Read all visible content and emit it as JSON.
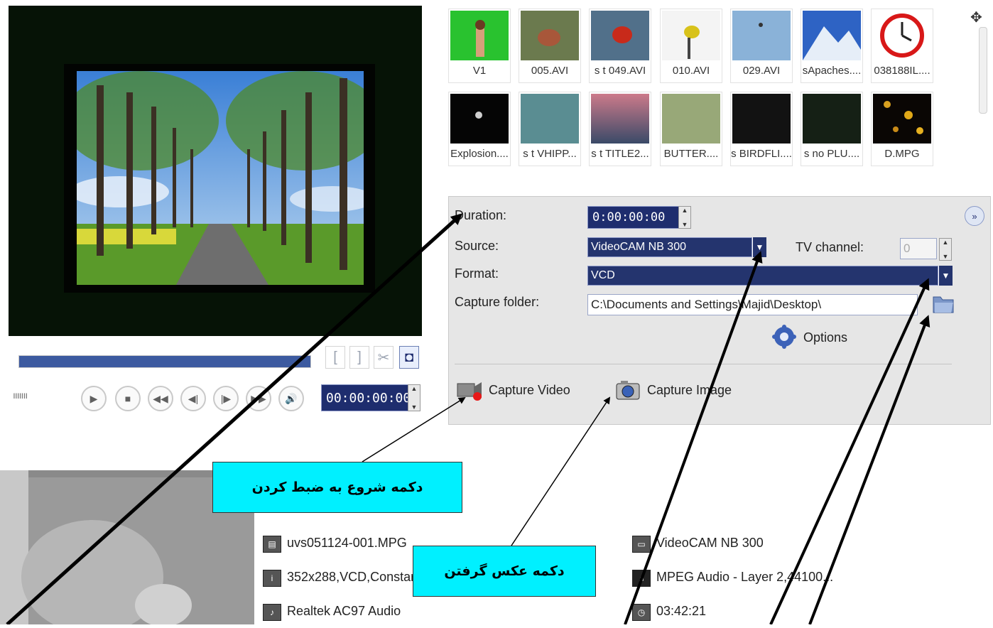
{
  "player": {
    "jog_marks": "ııııııı",
    "timecode": "00:00:00:00",
    "mark_in": "[",
    "mark_out": "]",
    "scissors": "✂",
    "snapshot": "◘"
  },
  "library": {
    "row1": [
      "V1",
      "005.AVI",
      "s t  049.AVI",
      "010.AVI",
      "029.AVI",
      "sApaches....",
      "038188IL...."
    ],
    "row2": [
      "Explosion....",
      "s t VHIPP...",
      "s t TITLE2...",
      "BUTTER....",
      "s BIRDFLI....",
      "s no  PLU....",
      "D.MPG"
    ]
  },
  "capture": {
    "duration_label": "Duration:",
    "duration_value": "0:00:00:00",
    "source_label": "Source:",
    "source_value": "VideoCAM NB 300",
    "tv_channel_label": "TV channel:",
    "tv_channel_value": "0",
    "format_label": "Format:",
    "format_value": "VCD",
    "folder_label": "Capture folder:",
    "folder_value": "C:\\Documents and Settings\\Majid\\Desktop\\",
    "options_label": "Options",
    "capture_video_label": "Capture Video",
    "capture_image_label": "Capture Image"
  },
  "info": {
    "file": "uvs051124-001.MPG",
    "video_props": "352x288,VCD,Constar",
    "audio_device": "Realtek AC97 Audio",
    "capture_device": "VideoCAM NB 300",
    "audio_format": "MPEG Audio - Layer 2,44100...",
    "time_left": "03:42:21"
  },
  "annotations": {
    "capture_start": "دکمه شروع به ضبط کردن",
    "take_photo": "دکمه عکس گرفتن"
  },
  "colors": {
    "accent": "#24346e",
    "callout": "#00f0ff",
    "arrow": "#000000"
  }
}
